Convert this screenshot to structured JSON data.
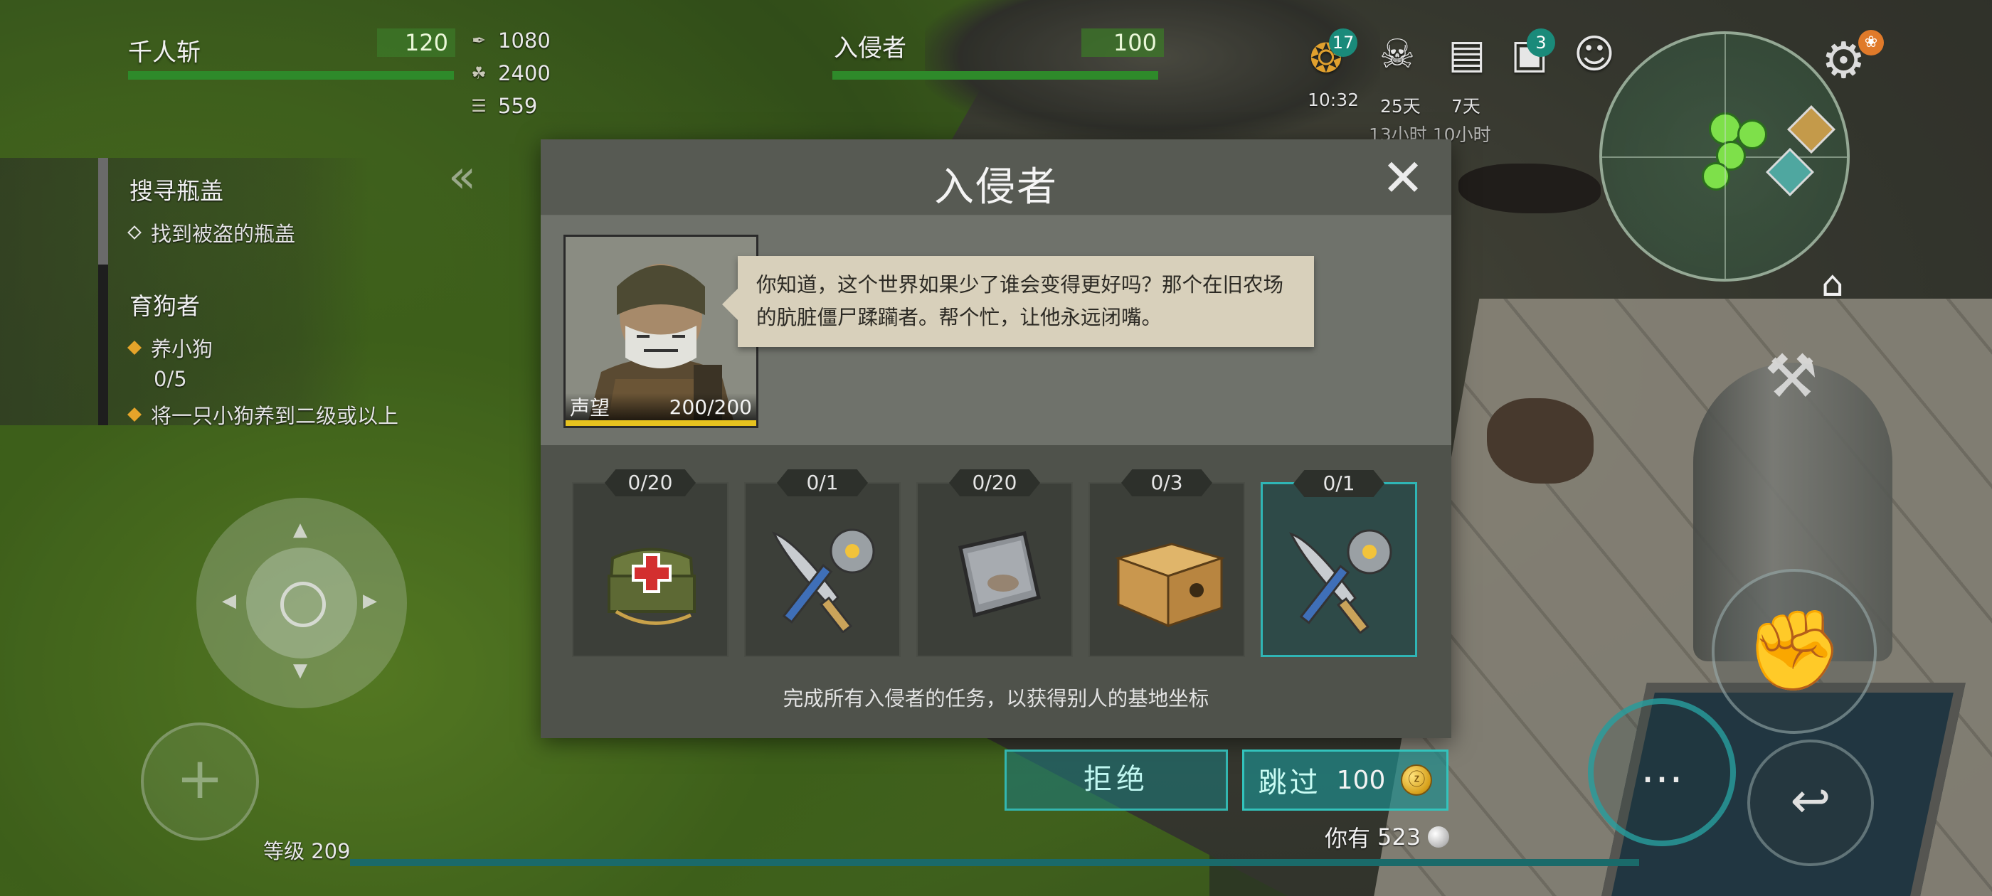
{
  "player": {
    "name": "千人斩",
    "level": "120"
  },
  "resources": [
    {
      "icon": "feather-icon",
      "value": "1080"
    },
    {
      "icon": "leaf-icon",
      "value": "2400"
    },
    {
      "icon": "scroll-icon",
      "value": "559"
    }
  ],
  "target": {
    "name": "入侵者",
    "level": "100"
  },
  "top_icons": {
    "sale": {
      "badge": "17",
      "sub": "10:32"
    },
    "skull": {
      "sub": "25天"
    },
    "dog_journal": {
      "sub": "7天"
    },
    "gift": {
      "badge": "3"
    },
    "timer_line": "13小时 10小时"
  },
  "quests": [
    {
      "title": "搜寻瓶盖",
      "items": [
        {
          "text": "找到被盗的瓶盖"
        }
      ]
    },
    {
      "title": "育狗者",
      "items": [
        {
          "text": "养小狗",
          "progress": "0/5"
        },
        {
          "text": "将一只小狗养到二级或以上"
        }
      ]
    }
  ],
  "dialog": {
    "title": "入侵者",
    "speech": "你知道，这个世界如果少了谁会变得更好吗？那个在旧农场的肮脏僵尸蹂躏者。帮个忙，让他永远闭嘴。",
    "portrait": {
      "label": "声望",
      "value": "200/200"
    },
    "tasks": [
      {
        "count": "0/20",
        "icon": "medkit-icon"
      },
      {
        "count": "0/1",
        "icon": "machete-sawblade-icon"
      },
      {
        "count": "0/20",
        "icon": "metal-plate-icon"
      },
      {
        "count": "0/3",
        "icon": "cardboard-box-icon"
      },
      {
        "count": "0/1",
        "icon": "machete-sawblade-icon",
        "selected": true
      }
    ],
    "hint": "完成所有入侵者的任务，以获得别人的基地坐标"
  },
  "buttons": {
    "refuse": "拒绝",
    "skip": "跳过",
    "skip_cost": "100"
  },
  "wallet": {
    "label": "你有",
    "amount": "523"
  },
  "level_label": "等级 209",
  "colors": {
    "accent_teal": "#33b6b0",
    "hp_green": "#2e8a2a",
    "badge_teal": "#1a8a7a",
    "gold": "#d6a01b"
  }
}
